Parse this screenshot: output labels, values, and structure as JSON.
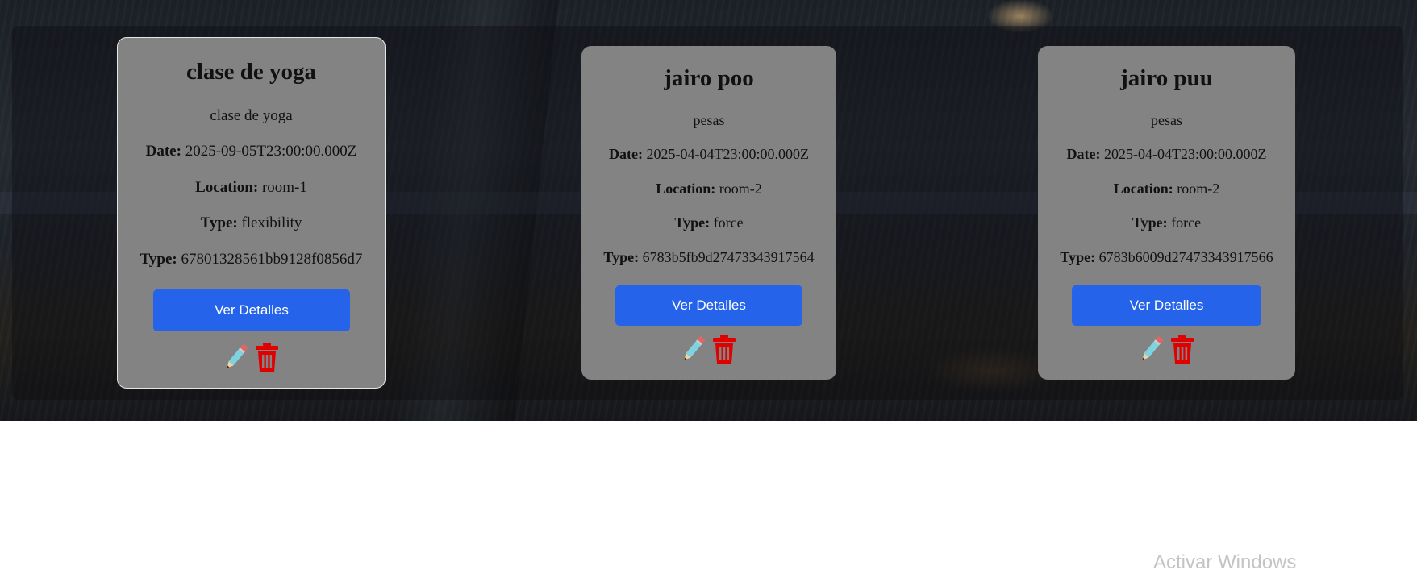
{
  "classes": [
    {
      "name": "clase de yoga",
      "description": "clase de yoga",
      "date_label": "Date:",
      "date": "2025-09-05T23:00:00.000Z",
      "location_label": "Location:",
      "location": "room-1",
      "type_label": "Type:",
      "type": "flexibility",
      "id_label": "Type:",
      "id": "67801328561bb9128f0856d7",
      "button_label": "Ver Detalles"
    },
    {
      "name": "jairo poo",
      "description": "pesas",
      "date_label": "Date:",
      "date": "2025-04-04T23:00:00.000Z",
      "location_label": "Location:",
      "location": "room-2",
      "type_label": "Type:",
      "type": "force",
      "id_label": "Type:",
      "id": "6783b5fb9d27473343917564",
      "button_label": "Ver Detalles"
    },
    {
      "name": "jairo puu",
      "description": "pesas",
      "date_label": "Date:",
      "date": "2025-04-04T23:00:00.000Z",
      "location_label": "Location:",
      "location": "room-2",
      "type_label": "Type:",
      "type": "force",
      "id_label": "Type:",
      "id": "6783b6009d27473343917566",
      "button_label": "Ver Detalles"
    }
  ],
  "icons": {
    "edit": "pencil-icon",
    "delete": "trash-icon"
  },
  "colors": {
    "button": "#2563eb",
    "card": "#838383",
    "delete_icon": "#e00000"
  },
  "watermark": "Activar Windows"
}
